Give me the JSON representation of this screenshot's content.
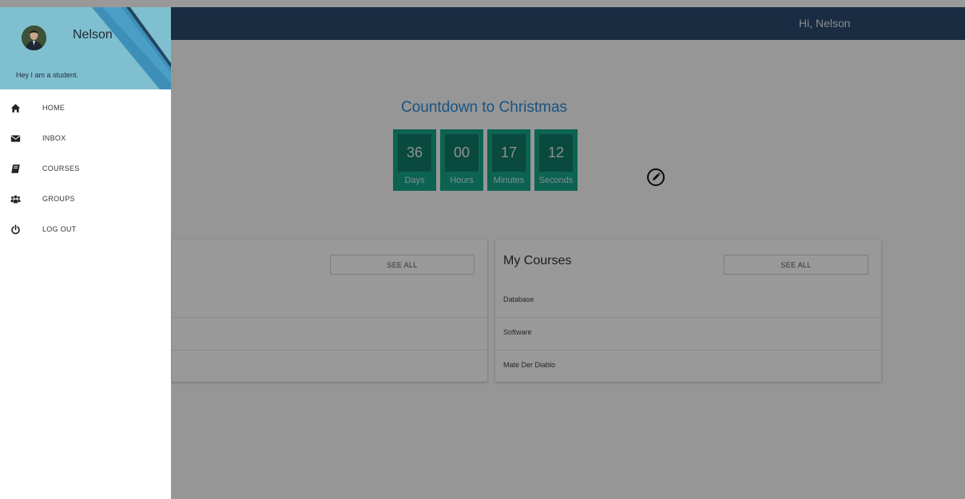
{
  "header": {
    "greeting": "Hi, Nelson"
  },
  "countdown": {
    "title": "Countdown to Christmas",
    "units": [
      {
        "value": "36",
        "label": "Days"
      },
      {
        "value": "00",
        "label": "Hours"
      },
      {
        "value": "17",
        "label": "Minutes"
      },
      {
        "value": "12",
        "label": "Seconds"
      }
    ],
    "edit_icon": "pencil-circle-icon"
  },
  "cards": {
    "left": {
      "see_all": "SEE ALL"
    },
    "right": {
      "title": "My Courses",
      "see_all": "SEE ALL",
      "rows": [
        "Database",
        "Software",
        "Mate Der Diablo"
      ]
    }
  },
  "drawer": {
    "username": "Nelson",
    "bio": "Hey I am a student.",
    "items": [
      {
        "label": "HOME",
        "icon": "home-icon"
      },
      {
        "label": "INBOX",
        "icon": "envelope-icon"
      },
      {
        "label": "COURSES",
        "icon": "book-icon"
      },
      {
        "label": "GROUPS",
        "icon": "users-icon"
      },
      {
        "label": "LOG OUT",
        "icon": "power-icon"
      }
    ]
  },
  "colors": {
    "topbar": "#2b4a6e",
    "countdown_title": "#2d8bd8",
    "countdown_tile": "#17a589",
    "drawer_header": "#7fbfcf"
  }
}
